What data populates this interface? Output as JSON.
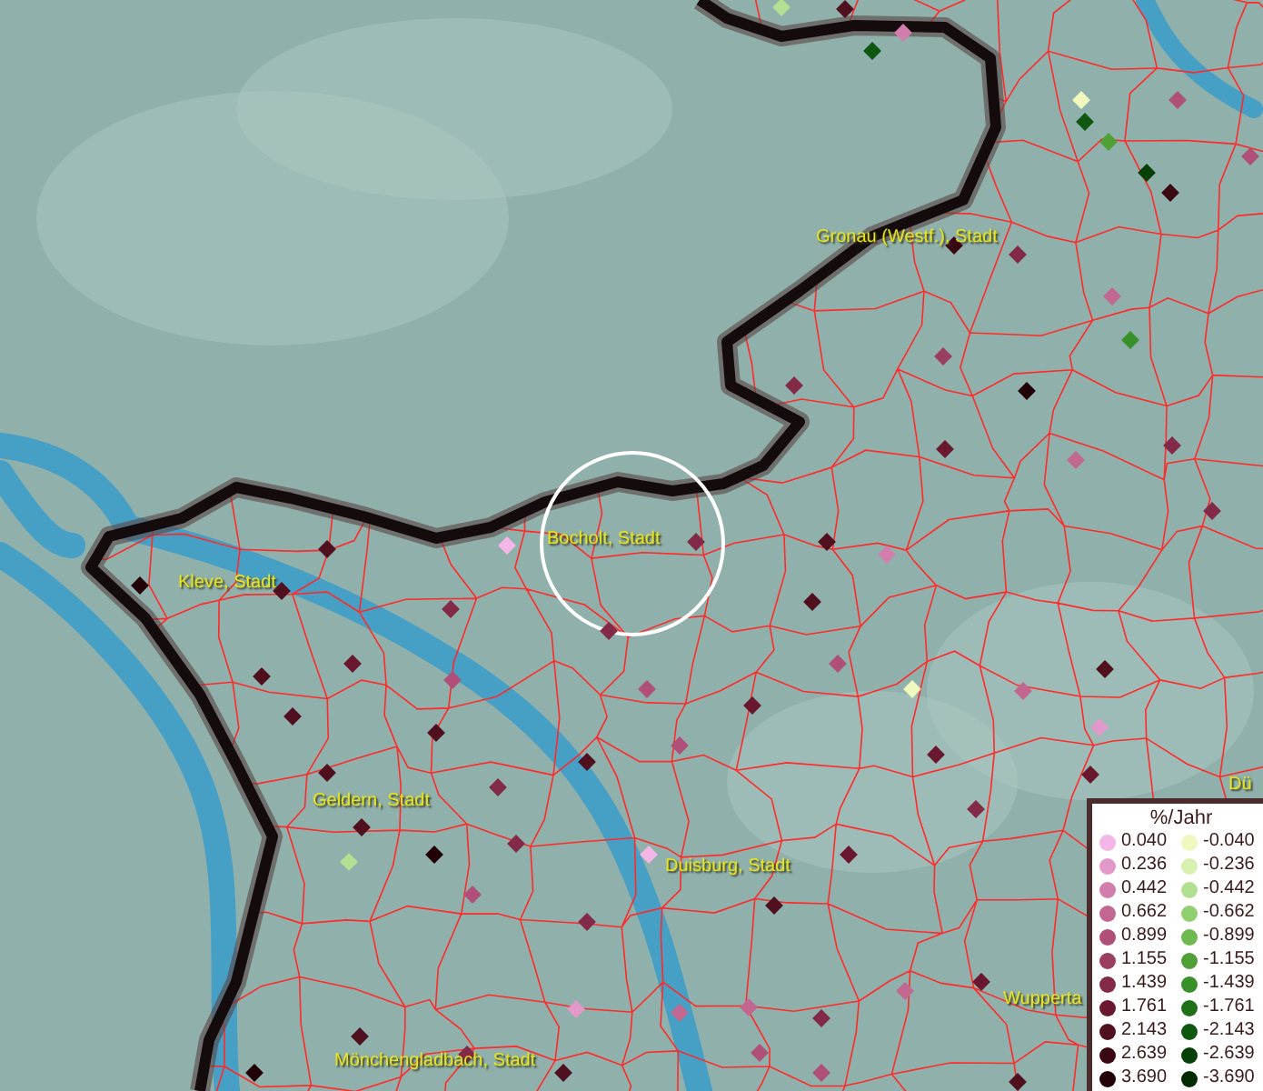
{
  "place_labels": [
    {
      "text": "Gronau (Westf.), Stadt"
    },
    {
      "text": "Bocholt, Stadt"
    },
    {
      "text": "Kleve, Stadt"
    },
    {
      "text": "Geldern, Stadt"
    },
    {
      "text": "Duisburg, Stadt"
    },
    {
      "text": "Wupperta"
    },
    {
      "text": "Mönchengladbach, Stadt"
    },
    {
      "text": "Dü"
    }
  ],
  "legend": {
    "title": "%/Jahr",
    "increase": [
      {
        "value": "0.040",
        "color": "#f4b6e6"
      },
      {
        "value": "0.236",
        "color": "#e298c8"
      },
      {
        "value": "0.442",
        "color": "#d27eac"
      },
      {
        "value": "0.662",
        "color": "#c26890"
      },
      {
        "value": "0.899",
        "color": "#b05078"
      },
      {
        "value": "1.155",
        "color": "#9a3e62"
      },
      {
        "value": "1.439",
        "color": "#822a48"
      },
      {
        "value": "1.761",
        "color": "#6a1830"
      },
      {
        "value": "2.143",
        "color": "#501020"
      },
      {
        "value": "2.639",
        "color": "#3a0812"
      },
      {
        "value": "3.690",
        "color": "#220008"
      }
    ],
    "decrease": [
      {
        "value": "-0.040",
        "color": "#f0f8c0"
      },
      {
        "value": "-0.236",
        "color": "#d8f0b0"
      },
      {
        "value": "-0.442",
        "color": "#b2e092"
      },
      {
        "value": "-0.662",
        "color": "#90d070"
      },
      {
        "value": "-0.899",
        "color": "#70b850"
      },
      {
        "value": "-1.155",
        "color": "#50a038"
      },
      {
        "value": "-1.439",
        "color": "#389028"
      },
      {
        "value": "-1.761",
        "color": "#207018"
      },
      {
        "value": "-2.143",
        "color": "#105810"
      },
      {
        "value": "-2.639",
        "color": "#084008"
      },
      {
        "value": "-3.690",
        "color": "#022a02"
      }
    ]
  }
}
